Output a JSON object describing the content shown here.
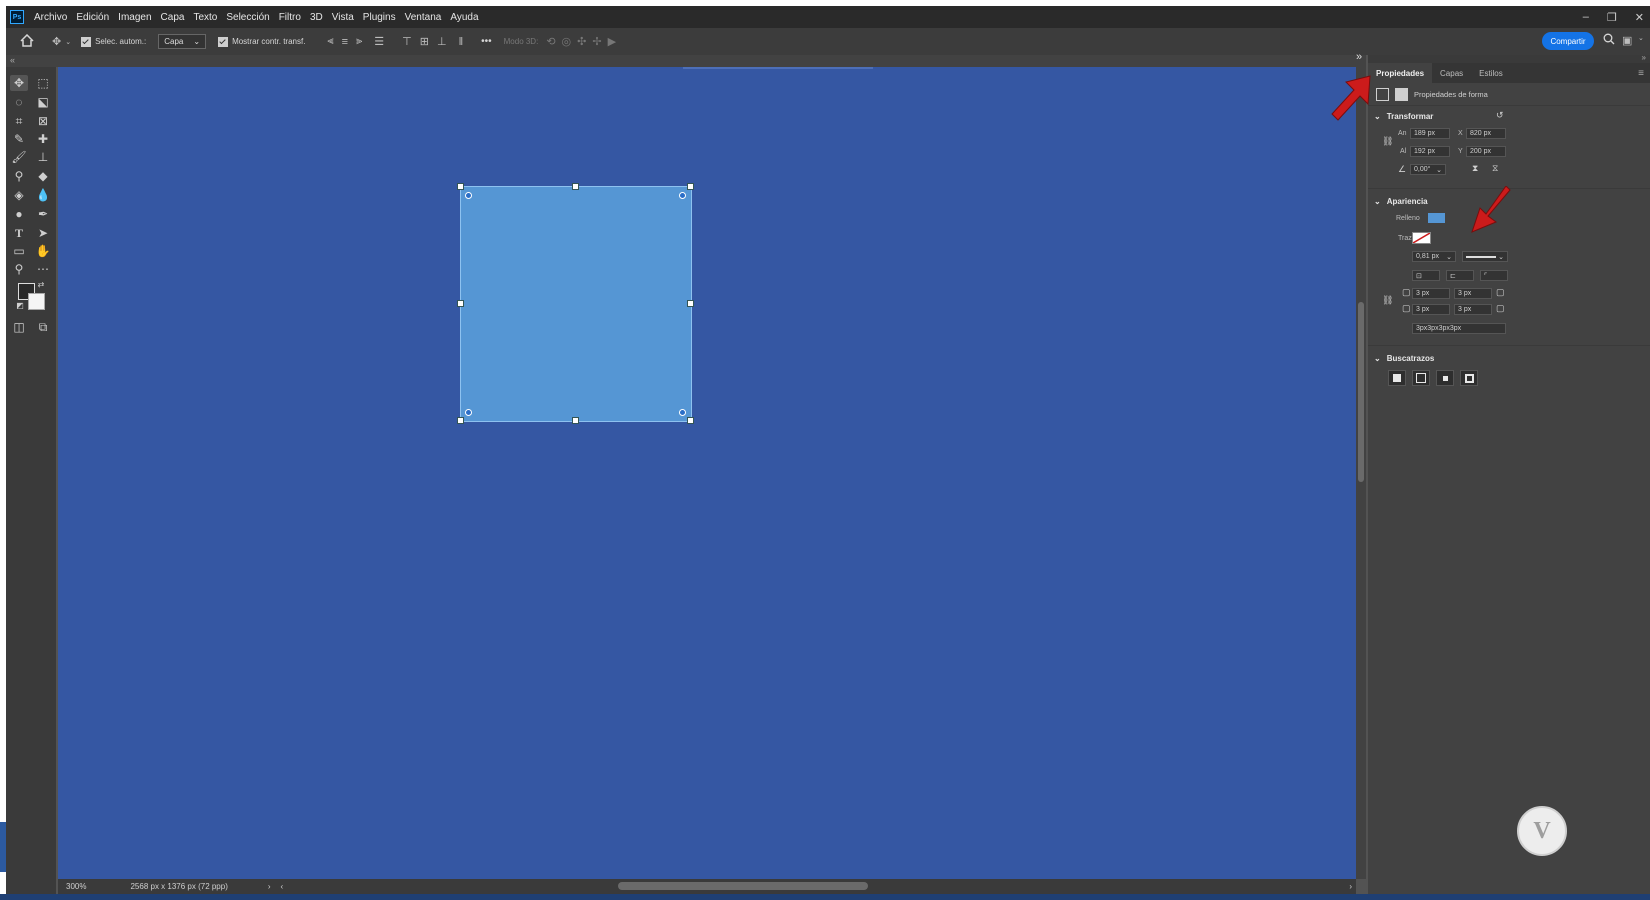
{
  "app": {
    "logo": "Ps"
  },
  "menu": [
    "Archivo",
    "Edición",
    "Imagen",
    "Capa",
    "Texto",
    "Selección",
    "Filtro",
    "3D",
    "Vista",
    "Plugins",
    "Ventana",
    "Ayuda"
  ],
  "window_controls": {
    "minimize": "–",
    "restore": "❐",
    "close": "✕"
  },
  "options_bar": {
    "auto_select_label": "Selec. autom.:",
    "auto_select_value": "Capa",
    "show_transform_label": "Mostrar contr. transf.",
    "more_label": "•••",
    "mode3d_label": "Modo 3D:",
    "share_label": "Compartir"
  },
  "status_bar": {
    "zoom": "300%",
    "doc_info": "2568 px x 1376 px (72 ppp)"
  },
  "panel": {
    "tabs": [
      "Propiedades",
      "Capas",
      "Estilos"
    ],
    "subheader": "Propiedades de forma",
    "transform": {
      "title": "Transformar",
      "an_label": "An",
      "an_value": "189 px",
      "x_label": "X",
      "x_value": "820 px",
      "al_label": "Al",
      "al_value": "192 px",
      "y_label": "Y",
      "y_value": "200 px",
      "angle_value": "0,00°"
    },
    "appearance": {
      "title": "Apariencia",
      "fill_label": "Relleno",
      "fill_color": "#5596d4",
      "stroke_label": "Trazo",
      "stroke_width": "0,81 px",
      "corner_tl": "3 px",
      "corner_tr": "3 px",
      "corner_bl": "3 px",
      "corner_br": "3 px",
      "corners_combined": "3px3px3px3px"
    },
    "pathfinder": {
      "title": "Buscatrazos"
    }
  },
  "colors": {
    "canvas_bg": "#3557a3",
    "shape_fill": "#5596d4",
    "accent_blue": "#1473e6",
    "annotation_red": "#cc1b1b"
  },
  "watermark": "V"
}
